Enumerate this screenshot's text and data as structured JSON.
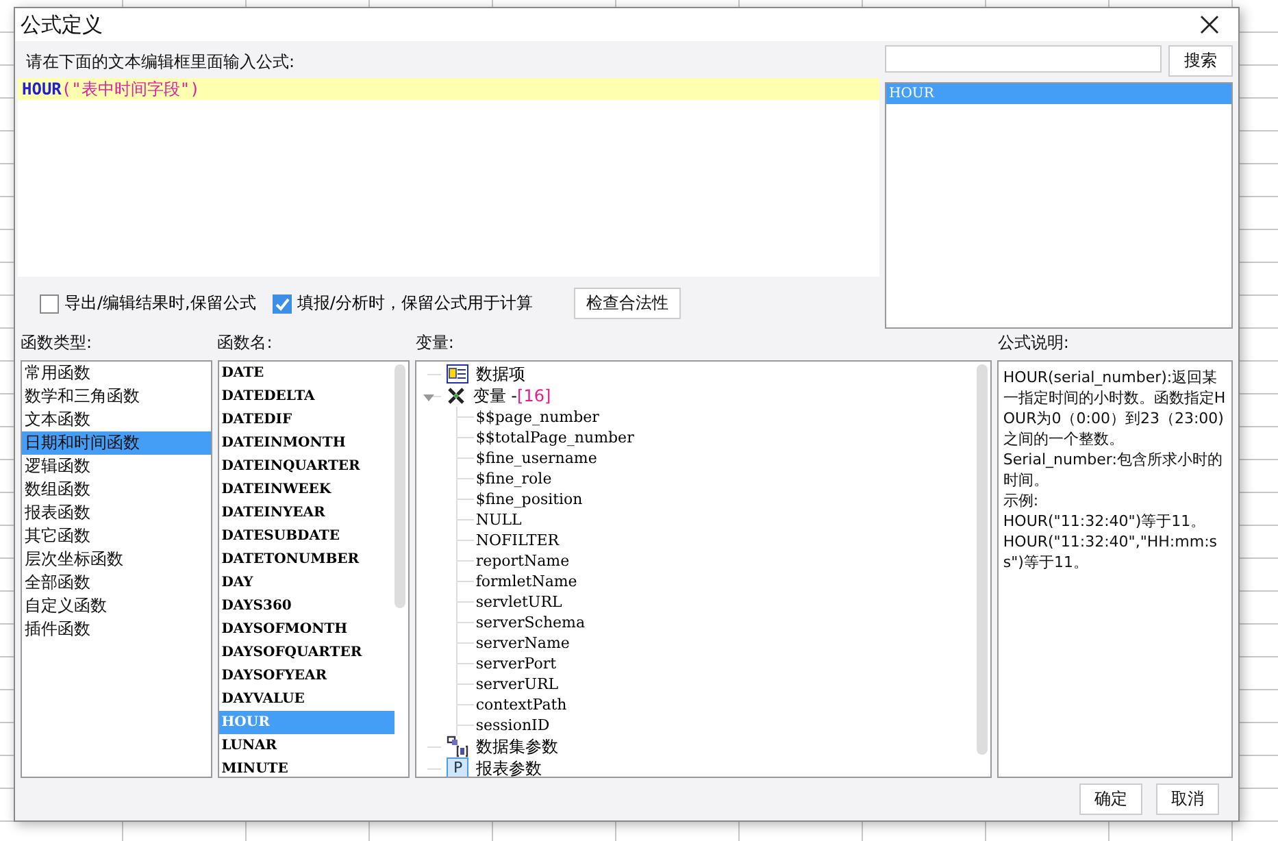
{
  "window": {
    "title": "公式定义"
  },
  "editor": {
    "prompt": "请在下面的文本编辑框里面输入公式:",
    "formula_function": "HOUR",
    "formula_args": "(\"表中时间字段\")"
  },
  "options": [
    {
      "label": "导出/编辑结果时,保留公式",
      "checked": false
    },
    {
      "label": "填报/分析时，保留公式用于计算",
      "checked": true
    }
  ],
  "check_button": "检查合法性",
  "search": {
    "button": "搜索",
    "results": [
      {
        "label": "HOUR",
        "selected": true
      }
    ]
  },
  "function_types": {
    "title": "函数类型:",
    "items": [
      {
        "label": "常用函数",
        "selected": false
      },
      {
        "label": "数学和三角函数",
        "selected": false
      },
      {
        "label": "文本函数",
        "selected": false
      },
      {
        "label": "日期和时间函数",
        "selected": true
      },
      {
        "label": "逻辑函数",
        "selected": false
      },
      {
        "label": "数组函数",
        "selected": false
      },
      {
        "label": "报表函数",
        "selected": false
      },
      {
        "label": "其它函数",
        "selected": false
      },
      {
        "label": "层次坐标函数",
        "selected": false
      },
      {
        "label": "全部函数",
        "selected": false
      },
      {
        "label": "自定义函数",
        "selected": false
      },
      {
        "label": "插件函数",
        "selected": false
      }
    ]
  },
  "function_names": {
    "title": "函数名:",
    "items": [
      {
        "label": "DATE",
        "selected": false
      },
      {
        "label": "DATEDELTA",
        "selected": false
      },
      {
        "label": "DATEDIF",
        "selected": false
      },
      {
        "label": "DATEINMONTH",
        "selected": false
      },
      {
        "label": "DATEINQUARTER",
        "selected": false
      },
      {
        "label": "DATEINWEEK",
        "selected": false
      },
      {
        "label": "DATEINYEAR",
        "selected": false
      },
      {
        "label": "DATESUBDATE",
        "selected": false
      },
      {
        "label": "DATETONUMBER",
        "selected": false
      },
      {
        "label": "DAY",
        "selected": false
      },
      {
        "label": "DAYS360",
        "selected": false
      },
      {
        "label": "DAYSOFMONTH",
        "selected": false
      },
      {
        "label": "DAYSOFQUARTER",
        "selected": false
      },
      {
        "label": "DAYSOFYEAR",
        "selected": false
      },
      {
        "label": "DAYVALUE",
        "selected": false
      },
      {
        "label": "HOUR",
        "selected": true
      },
      {
        "label": "LUNAR",
        "selected": false
      },
      {
        "label": "MINUTE",
        "selected": false
      }
    ]
  },
  "variables": {
    "title": "变量:",
    "tree": [
      {
        "kind": "data-item",
        "label": "数据项"
      },
      {
        "kind": "variables",
        "label": "变量 -",
        "count": "[16]",
        "expanded": true,
        "children": [
          {
            "label": "$$page_number"
          },
          {
            "label": "$$totalPage_number"
          },
          {
            "label": "$fine_username"
          },
          {
            "label": "$fine_role"
          },
          {
            "label": "$fine_position"
          },
          {
            "label": "NULL"
          },
          {
            "label": "NOFILTER"
          },
          {
            "label": "reportName"
          },
          {
            "label": "formletName"
          },
          {
            "label": "servletURL"
          },
          {
            "label": "serverSchema"
          },
          {
            "label": "serverName"
          },
          {
            "label": "serverPort"
          },
          {
            "label": "serverURL"
          },
          {
            "label": "contextPath"
          },
          {
            "label": "sessionID"
          }
        ]
      },
      {
        "kind": "dataset-params",
        "label": "数据集参数"
      },
      {
        "kind": "report-params",
        "label": "报表参数",
        "badge": "P"
      }
    ]
  },
  "description": {
    "title": "公式说明:",
    "paragraphs": [
      "HOUR(serial_number):返回某一指定时间的小时数。函数指定HOUR为0（0:00）到23（23:00)之间的一个整数。",
      "Serial_number:包含所求小时的时间。",
      "示例:",
      "HOUR(\"11:32:40\")等于11。",
      "HOUR(\"11:32:40\",\"HH:mm:ss\")等于11。"
    ]
  },
  "buttons": [
    "确定",
    "取消"
  ]
}
